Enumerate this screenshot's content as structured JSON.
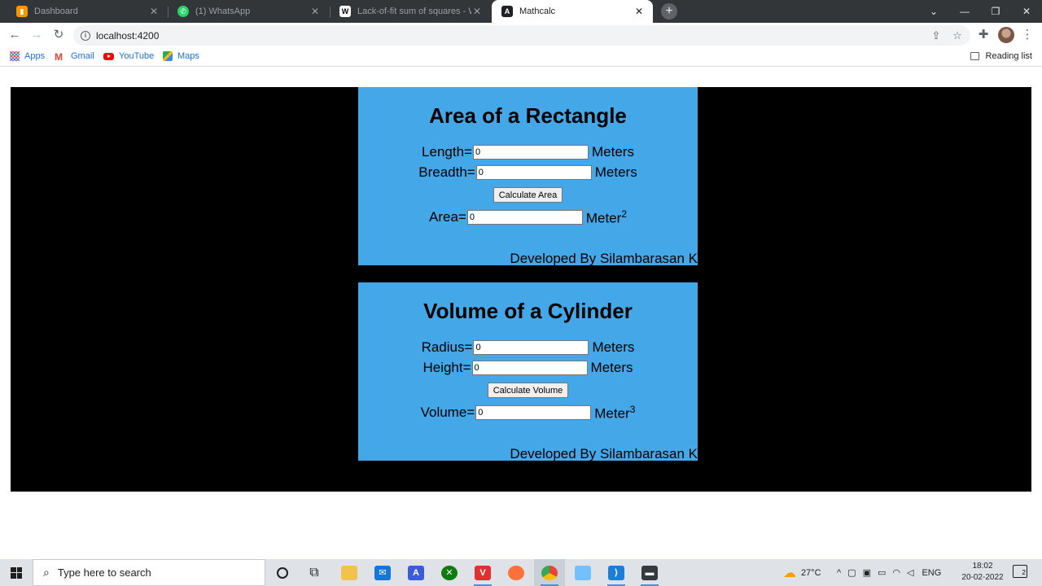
{
  "browser": {
    "tabs": [
      {
        "title": "Dashboard",
        "active": false
      },
      {
        "title": "(1) WhatsApp",
        "active": false
      },
      {
        "title": "Lack-of-fit sum of squares - Wiki",
        "active": false
      },
      {
        "title": "Mathcalc",
        "active": true
      }
    ],
    "new_tab": "+",
    "address": "localhost:4200",
    "bookmarks": [
      "Apps",
      "Gmail",
      "YouTube",
      "Maps"
    ],
    "reading_list": "Reading list"
  },
  "app": {
    "rectangle": {
      "title": "Area of a Rectangle",
      "length_label": "Length=",
      "length_value": "0",
      "breadth_label": "Breadth=",
      "breadth_value": "0",
      "unit": "Meters",
      "button": "Calculate Area",
      "result_label": "Area=",
      "result_value": "0",
      "result_unit": "Meter",
      "result_power": "2",
      "footer": "Developed By Silambarasan K"
    },
    "cylinder": {
      "title": "Volume of a Cylinder",
      "radius_label": "Radius=",
      "radius_value": "0",
      "height_label": "Height=",
      "height_value": "0",
      "unit": "Meters",
      "button": "Calculate Volume",
      "result_label": "Volume=",
      "result_value": "0",
      "result_unit": "Meter",
      "result_power": "3",
      "footer": "Developed By Silambarasan K"
    }
  },
  "taskbar": {
    "search_placeholder": "Type here to search",
    "weather": "27°C",
    "language": "ENG",
    "time": "18:02",
    "date": "20-02-2022",
    "notifications": "2"
  }
}
